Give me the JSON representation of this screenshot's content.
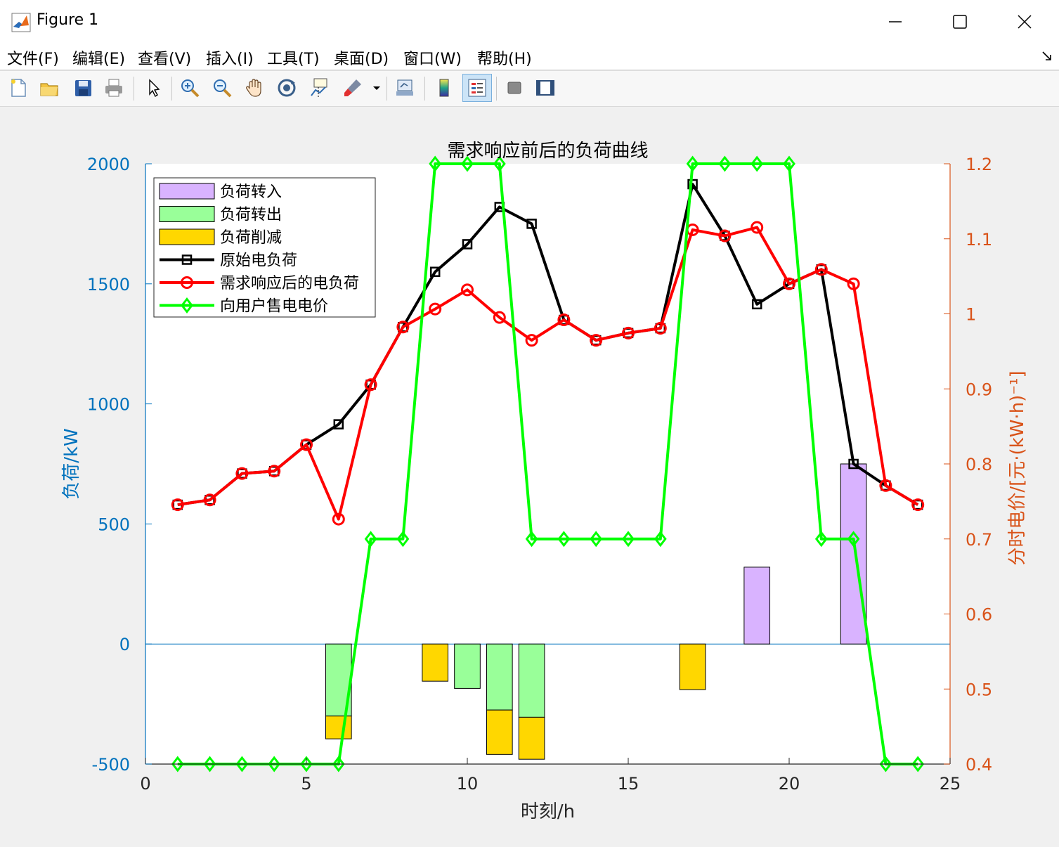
{
  "window": {
    "title": "Figure 1"
  },
  "menu": {
    "items": [
      "文件(F)",
      "编辑(E)",
      "查看(V)",
      "插入(I)",
      "工具(T)",
      "桌面(D)",
      "窗口(W)",
      "帮助(H)"
    ]
  },
  "toolbar": {
    "icons": [
      "new-file-icon",
      "open-folder-icon",
      "save-icon",
      "print-icon",
      "pointer-icon",
      "zoom-in-icon",
      "zoom-out-icon",
      "pan-hand-icon",
      "rotate-3d-icon",
      "data-cursor-icon",
      "brush-icon",
      "dropdown-arrow-icon",
      "link-plot-icon",
      "colorbar-icon",
      "legend-icon",
      "hide-plot-tools-icon",
      "show-plot-tools-icon"
    ]
  },
  "chart_data": {
    "type": "bar+line",
    "title": "需求响应前后的负荷曲线",
    "xlabel": "时刻/h",
    "ylabel_left": "负荷/kW",
    "ylabel_right": "分时电价/[元·(kW·h)⁻¹]",
    "xlim": [
      0,
      25
    ],
    "ylim_left": [
      -500,
      2000
    ],
    "ylim_right": [
      0.4,
      1.2
    ],
    "xticks": [
      "0",
      "5",
      "10",
      "15",
      "20",
      "25"
    ],
    "yticks_left": [
      "-500",
      "0",
      "500",
      "1000",
      "1500",
      "2000"
    ],
    "yticks_right": [
      "0.4",
      "0.5",
      "0.6",
      "0.7",
      "0.8",
      "0.9",
      "1",
      "1.1",
      "1.2"
    ],
    "colors": {
      "left_axis": "#0072BD",
      "right_axis": "#D95319",
      "shift_in": "#D9B3FF",
      "shift_out": "#99FF99",
      "curtail": "#FFD700",
      "original": "#000000",
      "after_dr": "#FF0000",
      "price": "#00FF00"
    },
    "legend": {
      "placement": "top-left",
      "entries": [
        "负荷转入",
        "负荷转出",
        "负荷削减",
        "原始电负荷",
        "需求响应后的电负荷",
        "向用户售电电价"
      ]
    },
    "x": [
      1,
      2,
      3,
      4,
      5,
      6,
      7,
      8,
      9,
      10,
      11,
      12,
      13,
      14,
      15,
      16,
      17,
      18,
      19,
      20,
      21,
      22,
      23,
      24
    ],
    "bars": {
      "shift_in": [
        0,
        0,
        0,
        0,
        0,
        0,
        0,
        0,
        0,
        0,
        0,
        0,
        0,
        0,
        0,
        0,
        0,
        0,
        320,
        0,
        0,
        750,
        0,
        0
      ],
      "shift_out": [
        0,
        0,
        0,
        0,
        0,
        -300,
        0,
        0,
        0,
        -185,
        -275,
        -305,
        0,
        0,
        0,
        0,
        0,
        0,
        0,
        0,
        0,
        0,
        0,
        0
      ],
      "curtail": [
        0,
        0,
        0,
        0,
        0,
        -95,
        0,
        0,
        -155,
        0,
        -185,
        -175,
        0,
        0,
        0,
        0,
        -190,
        0,
        0,
        0,
        0,
        0,
        0,
        0
      ]
    },
    "series": [
      {
        "name": "原始电负荷",
        "axis": "left",
        "values": [
          580,
          600,
          710,
          720,
          830,
          915,
          1080,
          1320,
          1550,
          1665,
          1820,
          1750,
          1350,
          1265,
          1295,
          1315,
          1915,
          1700,
          1415,
          1500,
          1560,
          750,
          660,
          580
        ]
      },
      {
        "name": "需求响应后的电负荷",
        "axis": "left",
        "values": [
          580,
          600,
          710,
          720,
          830,
          520,
          1080,
          1320,
          1395,
          1475,
          1360,
          1265,
          1350,
          1265,
          1295,
          1315,
          1725,
          1700,
          1735,
          1500,
          1560,
          1500,
          660,
          580
        ]
      },
      {
        "name": "向用户售电电价",
        "axis": "right",
        "values": [
          0.4,
          0.4,
          0.4,
          0.4,
          0.4,
          0.4,
          0.7,
          0.7,
          1.2,
          1.2,
          1.2,
          0.7,
          0.7,
          0.7,
          0.7,
          0.7,
          1.2,
          1.2,
          1.2,
          1.2,
          0.7,
          0.7,
          0.4,
          0.4
        ]
      }
    ]
  }
}
